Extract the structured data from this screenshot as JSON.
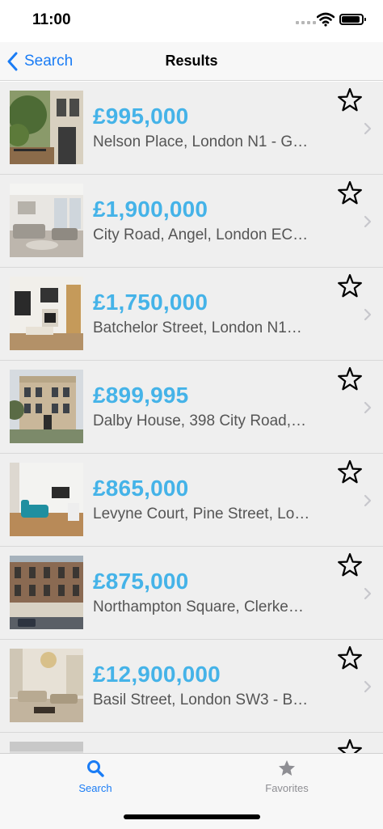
{
  "status_bar": {
    "time": "11:00"
  },
  "nav": {
    "back_label": "Search",
    "title": "Results"
  },
  "listings": [
    {
      "price": "£995,000",
      "title": "Nelson Place, London N1 - G…",
      "photo": "street-house"
    },
    {
      "price": "£1,900,000",
      "title": "City Road, Angel, London EC…",
      "photo": "white-lounge"
    },
    {
      "price": "£1,750,000",
      "title": "Batchelor Street, London N1…",
      "photo": "living-room"
    },
    {
      "price": "£899,995",
      "title": "Dalby House, 398 City Road,…",
      "photo": "victorian-building"
    },
    {
      "price": "£865,000",
      "title": "Levyne Court, Pine Street, Lo…",
      "photo": "teal-sofa-room"
    },
    {
      "price": "£875,000",
      "title": "Northampton Square, Clerke…",
      "photo": "terrace-facade"
    },
    {
      "price": "£12,900,000",
      "title": "Basil Street, London SW3 - B…",
      "photo": "luxury-lounge"
    },
    {
      "price": "",
      "title": "",
      "photo": "partial"
    }
  ],
  "tabs": [
    {
      "label": "Search",
      "icon": "search-icon",
      "active": true
    },
    {
      "label": "Favorites",
      "icon": "star-icon",
      "active": false
    }
  ],
  "colors": {
    "accent": "#1a7cf5",
    "price": "#45b3e8",
    "list_bg": "#efefef"
  }
}
